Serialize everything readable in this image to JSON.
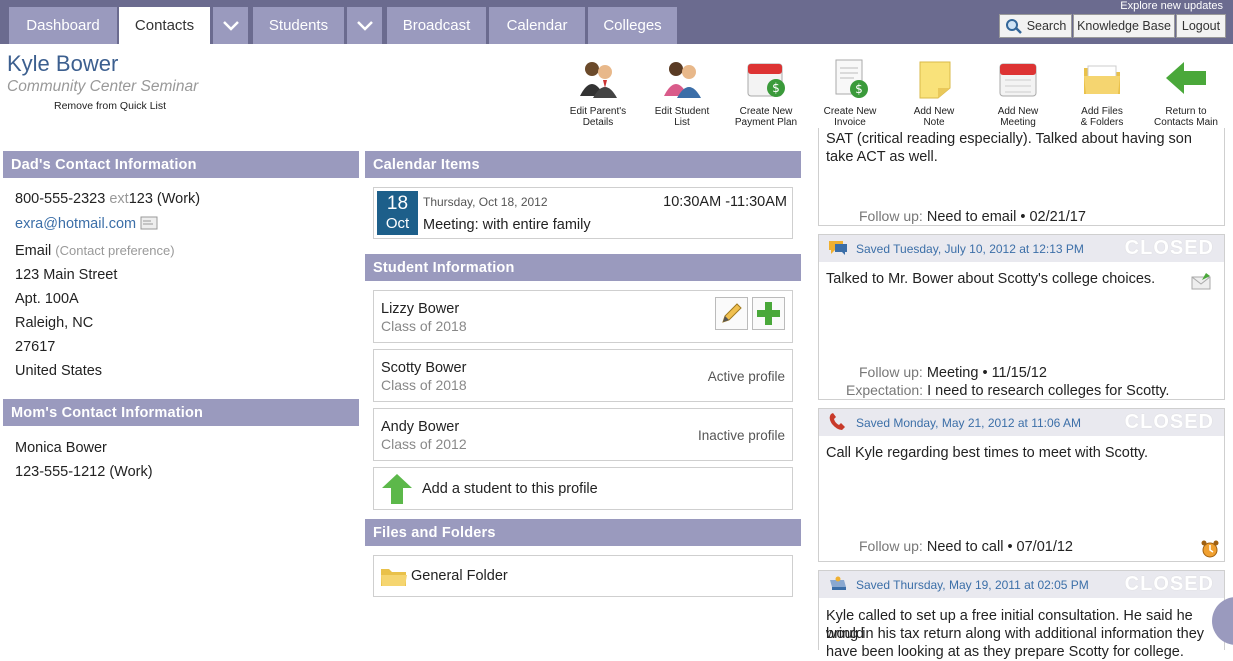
{
  "nav": {
    "tabs": [
      {
        "label": "Dashboard"
      },
      {
        "label": "Contacts"
      },
      {
        "label": "Students"
      },
      {
        "label": "Broadcast"
      },
      {
        "label": "Calendar"
      },
      {
        "label": "Colleges"
      }
    ],
    "explore": "Explore new updates",
    "search": "Search",
    "knowledge_base": "Knowledge Base",
    "logout": "Logout"
  },
  "contact": {
    "name": "Kyle Bower",
    "org": "Community Center Seminar",
    "remove_quick_list": "Remove from Quick List"
  },
  "toolbar": [
    {
      "l1": "Edit Parent's",
      "l2": "Details"
    },
    {
      "l1": "Edit Student",
      "l2": "List"
    },
    {
      "l1": "Create New",
      "l2": "Payment Plan"
    },
    {
      "l1": "Create New",
      "l2": "Invoice"
    },
    {
      "l1": "Add New",
      "l2": "Note"
    },
    {
      "l1": "Add New",
      "l2": "Meeting"
    },
    {
      "l1": "Add Files",
      "l2": "& Folders"
    },
    {
      "l1": "Return to",
      "l2": "Contacts Main"
    }
  ],
  "dad": {
    "heading": "Dad's Contact Information",
    "phone": "800-555-2323",
    "ext_label": "ext",
    "ext": "123 (Work)",
    "email": "exra@hotmail.com",
    "email_label": "Email",
    "pref_label": "(Contact preference)",
    "street": "123 Main Street",
    "apt": "Apt. 100A",
    "city": "Raleigh, NC",
    "zip": "27617",
    "country": "United States"
  },
  "mom": {
    "heading": "Mom's Contact Information",
    "name": "Monica Bower",
    "phone": "123-555-1212 (Work)"
  },
  "calendar": {
    "heading": "Calendar Items",
    "day": "18",
    "month": "Oct",
    "date": "Thursday, Oct 18, 2012",
    "time": "10:30AM -11:30AM",
    "title": "Meeting: with entire family"
  },
  "students": {
    "heading": "Student Information",
    "items": [
      {
        "name": "Lizzy Bower",
        "class": "Class of 2018",
        "status": ""
      },
      {
        "name": "Scotty Bower",
        "class": "Class of 2018",
        "status": "Active profile"
      },
      {
        "name": "Andy Bower",
        "class": "Class of 2012",
        "status": "Inactive profile"
      }
    ],
    "add": "Add a student to this profile"
  },
  "files": {
    "heading": "Files and Folders",
    "folder": "General Folder"
  },
  "notes": {
    "top_l1": "SAT (critical reading especially). Talked about having son",
    "top_l2": "take ACT as well.",
    "top_followup_label": "Follow up:",
    "top_followup": "Need to email  • 02/21/17",
    "items": [
      {
        "saved": "Saved Tuesday, July 10, 2012 at 12:13 PM",
        "closed": "CLOSED",
        "text": "Talked to Mr. Bower about Scotty's college choices.",
        "followup_label": "Follow up:",
        "followup": "Meeting  • 11/15/12",
        "expect_label": "Expectation:",
        "expect": "I need to research colleges for Scotty."
      },
      {
        "saved": "Saved Monday, May 21, 2012 at 11:06 AM",
        "closed": "CLOSED",
        "text": "Call Kyle regarding best times to meet with Scotty.",
        "followup_label": "Follow up:",
        "followup": "Need to call  • 07/01/12"
      },
      {
        "saved": "Saved Thursday, May 19, 2011 at 02:05 PM",
        "closed": "CLOSED",
        "l1": "Kyle called to set up a free initial consultation. He said he would",
        "l2": "bring in his tax return along with additional information they",
        "l3": "have been looking at as they prepare Scotty for college."
      }
    ]
  },
  "colors": {
    "nav_bg": "#6b6b8f",
    "tab_bg": "#9a9abe",
    "panel_head": "#9a9abe",
    "name_blue": "#3c5f8f",
    "calendar_date": "#1d5f8a"
  }
}
